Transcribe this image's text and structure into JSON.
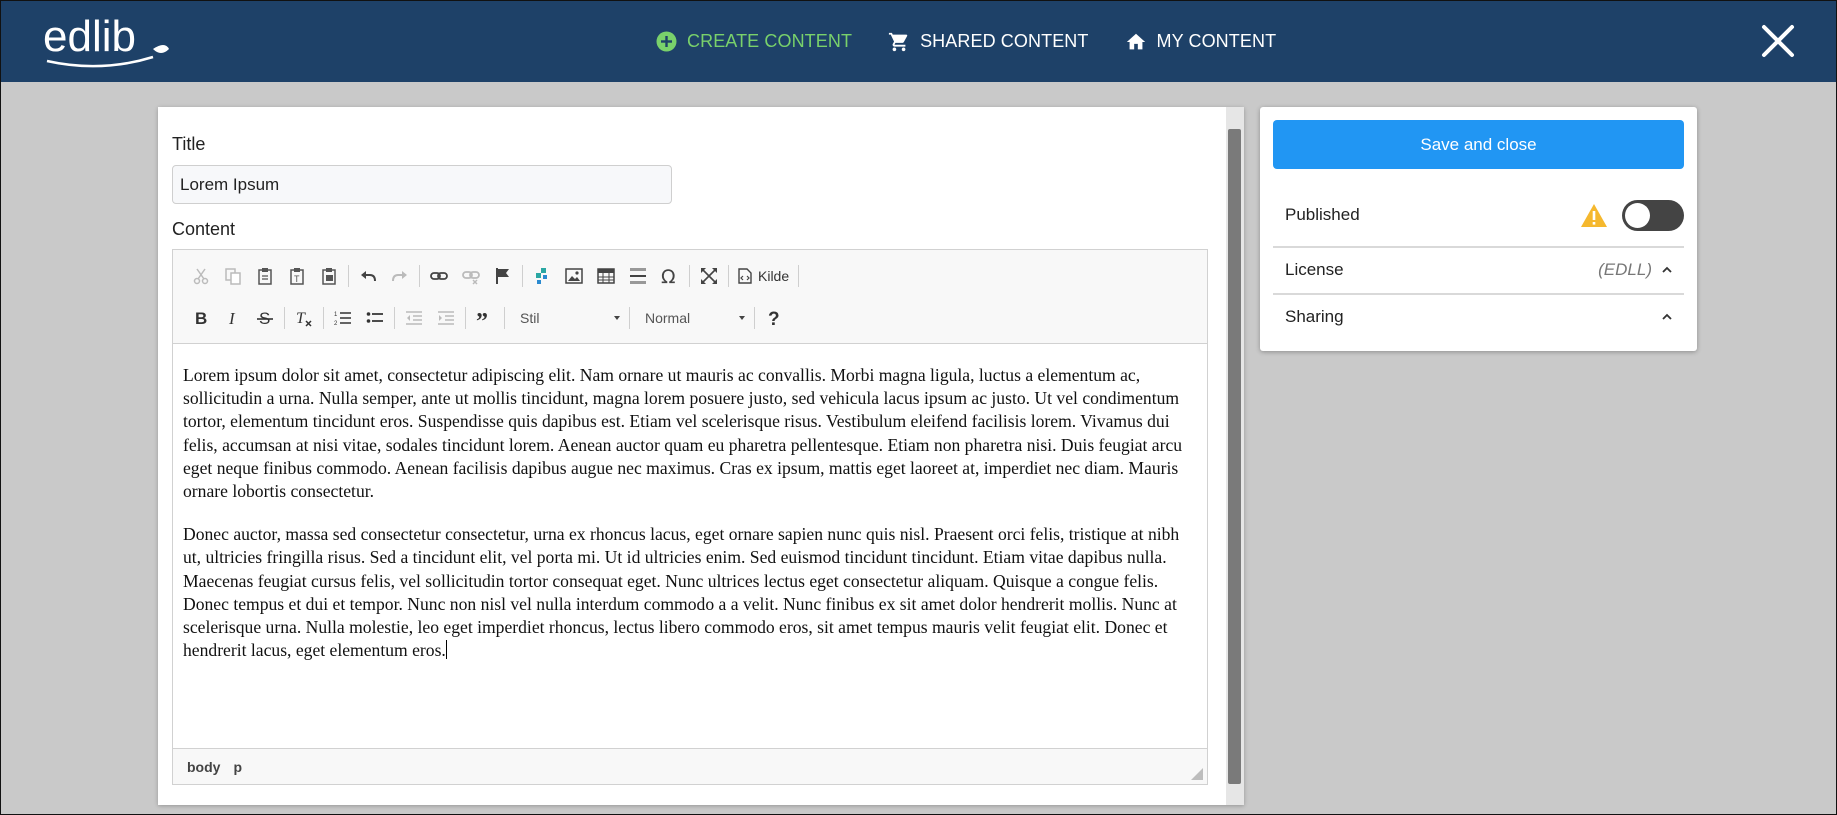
{
  "header": {
    "logo_text": "edlib",
    "nav": [
      {
        "label": "CREATE CONTENT",
        "icon": "plus-circle-icon",
        "active": true
      },
      {
        "label": "SHARED CONTENT",
        "icon": "cart-icon",
        "active": false
      },
      {
        "label": "MY CONTENT",
        "icon": "home-icon",
        "active": false
      }
    ],
    "colors": {
      "bar": "#1e4168",
      "active": "#79d16b"
    }
  },
  "editor": {
    "title_label": "Title",
    "title_value": "Lorem Ipsum",
    "content_label": "Content",
    "toolbar": {
      "source_label": "Kilde",
      "style_combo": "Stil",
      "format_combo": "Normal"
    },
    "paragraphs": [
      "Lorem ipsum dolor sit amet, consectetur adipiscing elit. Nam ornare ut mauris ac convallis. Morbi magna ligula, luctus a elementum ac, sollicitudin a urna. Nulla semper, ante ut mollis tincidunt, magna lorem posuere justo, sed vehicula lacus ipsum ac justo. Ut vel condimentum tortor, elementum tincidunt eros. Suspendisse quis dapibus est. Etiam vel scelerisque risus. Vestibulum eleifend facilisis lorem. Vivamus dui felis, accumsan at nisi vitae, sodales tincidunt lorem. Aenean auctor quam eu pharetra pellentesque. Etiam non pharetra nisi. Duis feugiat arcu eget neque finibus commodo. Aenean facilisis dapibus augue nec maximus. Cras ex ipsum, mattis eget laoreet at, imperdiet nec diam. Mauris ornare lobortis consectetur.",
      "Donec auctor, massa sed consectetur consectetur, urna ex rhoncus lacus, eget ornare sapien nunc quis nisl. Praesent orci felis, tristique at nibh ut, ultricies fringilla risus. Sed a tincidunt elit, vel porta mi. Ut id ultricies enim. Sed euismod tincidunt tincidunt. Etiam vitae dapibus nulla. Maecenas feugiat cursus felis, vel sollicitudin tortor consequat eget. Nunc ultrices lectus eget consectetur aliquam. Quisque a congue felis. Donec tempus et dui et tempor. Nunc non nisl vel nulla interdum commodo a a velit. Nunc finibus ex sit amet dolor hendrerit mollis. Nunc at scelerisque urna. Nulla molestie, leo eget imperdiet rhoncus, lectus libero commodo eros, sit amet tempus mauris velit feugiat elit. Donec et hendrerit lacus, eget elementum eros."
    ],
    "path": [
      "body",
      "p"
    ]
  },
  "sidebar": {
    "save_label": "Save and close",
    "published_label": "Published",
    "published": false,
    "license_label": "License",
    "license_value": "(EDLL)",
    "sharing_label": "Sharing",
    "colors": {
      "save": "#2196f3",
      "warning": "#f5b82e"
    }
  }
}
